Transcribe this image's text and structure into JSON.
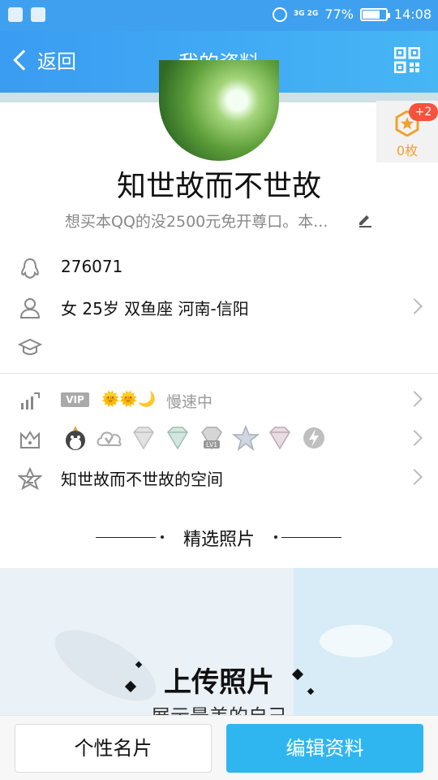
{
  "status_bar": {
    "battery": "77%",
    "time": "14:08",
    "network": "3G 2G",
    "battery_level": 0.77
  },
  "nav": {
    "back_label": "返回",
    "title": "我的资料"
  },
  "badge": {
    "count": "0枚",
    "plus": "+2"
  },
  "profile": {
    "nickname": "知世故而不世故",
    "signature": "想买本QQ的没2500元免开尊口。本..."
  },
  "info": {
    "qq_number": "276071",
    "basic": "女  25岁  双鱼座  河南-信阳",
    "vip_tag": "VIP",
    "level_icons": "🌞🌞🌙",
    "level_status": "慢速中",
    "space": "知世故而不世故的空间",
    "service_badge_label": "LV1"
  },
  "photos": {
    "section_title": "精选照片",
    "upload_title": "上传照片",
    "upload_subtitle": "展示最美的自己"
  },
  "bottom": {
    "card_label": "个性名片",
    "edit_label": "编辑资料"
  },
  "colors": {
    "accent": "#3a9cf2",
    "edit_button": "#2fb6f0",
    "badge_red": "#f5533d",
    "badge_gold": "#f0a12b"
  }
}
